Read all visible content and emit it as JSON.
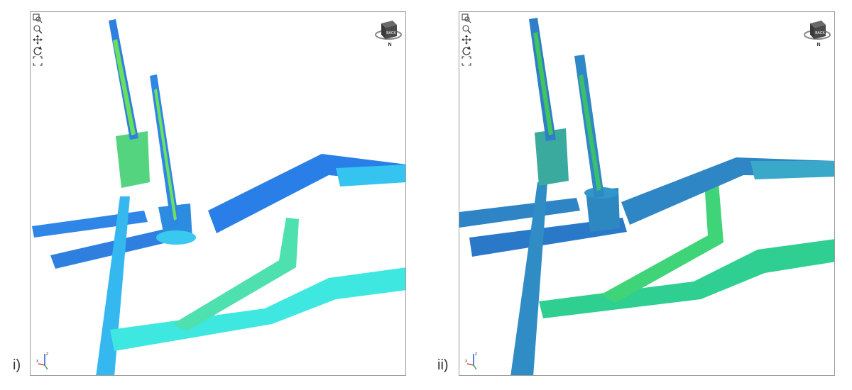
{
  "panels": [
    {
      "label": "i)",
      "navcube": {
        "face_label": "BACK",
        "compass_label": "N"
      },
      "triad": {
        "z": "Z",
        "x": "X"
      },
      "toolbar": [
        "zoom-window-icon",
        "zoom-icon",
        "pan-icon",
        "rotate-icon",
        "fit-view-icon"
      ],
      "colors": {
        "base": "#35c4f0",
        "mid": "#3fe0e8",
        "hot": "#58e05a",
        "deep": "#1a64e0"
      }
    },
    {
      "label": "ii)",
      "navcube": {
        "face_label": "BACK",
        "compass_label": "N"
      },
      "triad": {
        "z": "Z",
        "x": "X"
      },
      "toolbar": [
        "zoom-window-icon",
        "zoom-icon",
        "pan-icon",
        "rotate-icon",
        "fit-view-icon"
      ],
      "colors": {
        "base": "#2f8fc2",
        "mid": "#2dc49b",
        "hot": "#4bd669",
        "deep": "#1a5fc0"
      }
    }
  ]
}
